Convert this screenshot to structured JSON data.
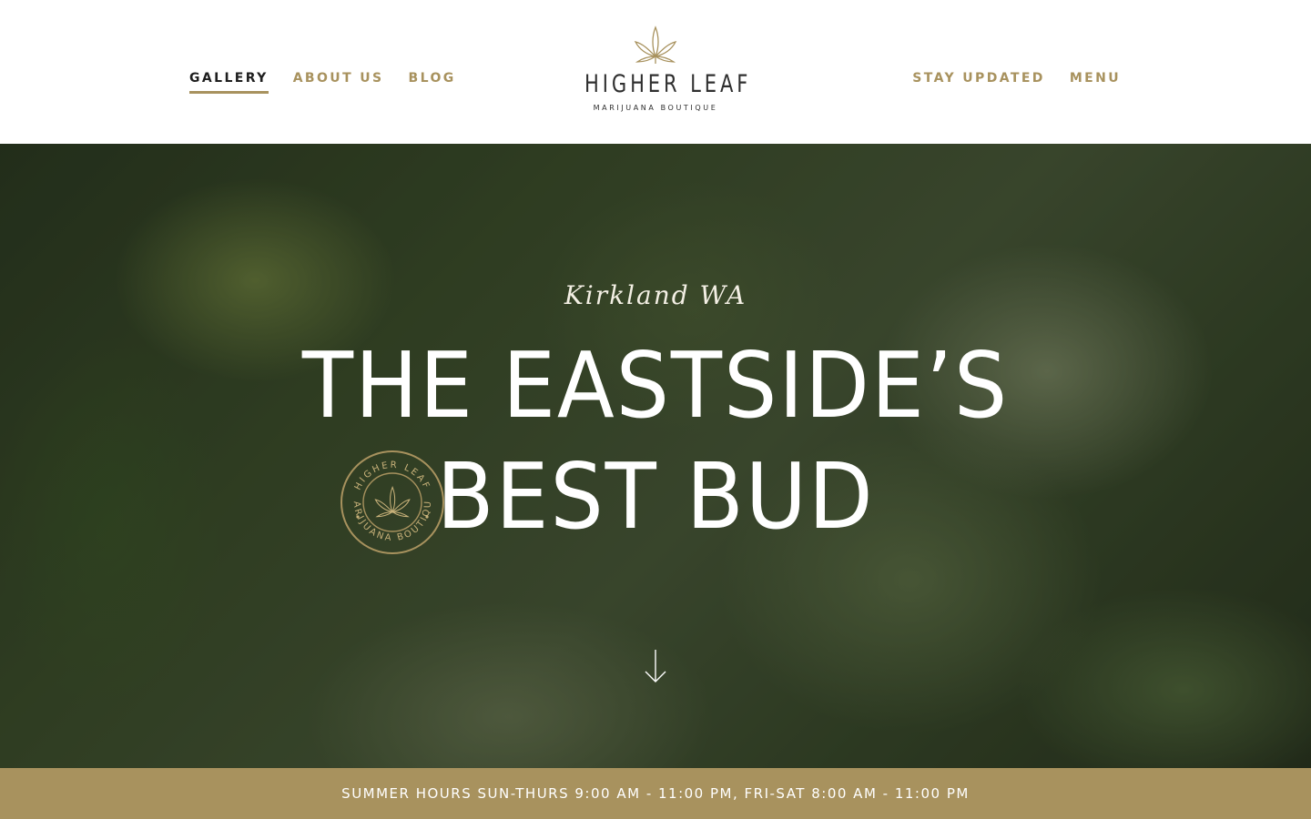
{
  "nav": {
    "left": [
      {
        "label": "GALLERY",
        "active": true
      },
      {
        "label": "ABOUT US",
        "active": false
      },
      {
        "label": "BLOG",
        "active": false
      }
    ],
    "right": [
      {
        "label": "STAY UPDATED"
      },
      {
        "label": "MENU"
      }
    ]
  },
  "logo": {
    "name": "HIGHER LEAF",
    "tagline": "MARIJUANA BOUTIQUE",
    "icon": "cannabis-leaf-icon"
  },
  "hero": {
    "subtitle": "Kirkland WA",
    "title_line1": "THE EASTSIDE’S",
    "title_line2": "BEST BUD",
    "seal": {
      "top_text": "HIGHER LEAF",
      "bottom_text": "MARIJUANA BOUTIQUE",
      "icon": "cannabis-leaf-icon"
    },
    "scroll_icon": "arrow-down-icon"
  },
  "hours": {
    "text": "SUMMER HOURS SUN-THURS 9:00 AM - 11:00 PM, FRI-SAT 8:00 AM - 11:00 PM"
  },
  "colors": {
    "accent": "#a8925e",
    "nav_active": "#1e1e1e",
    "logo_text": "#2f2f2f"
  }
}
